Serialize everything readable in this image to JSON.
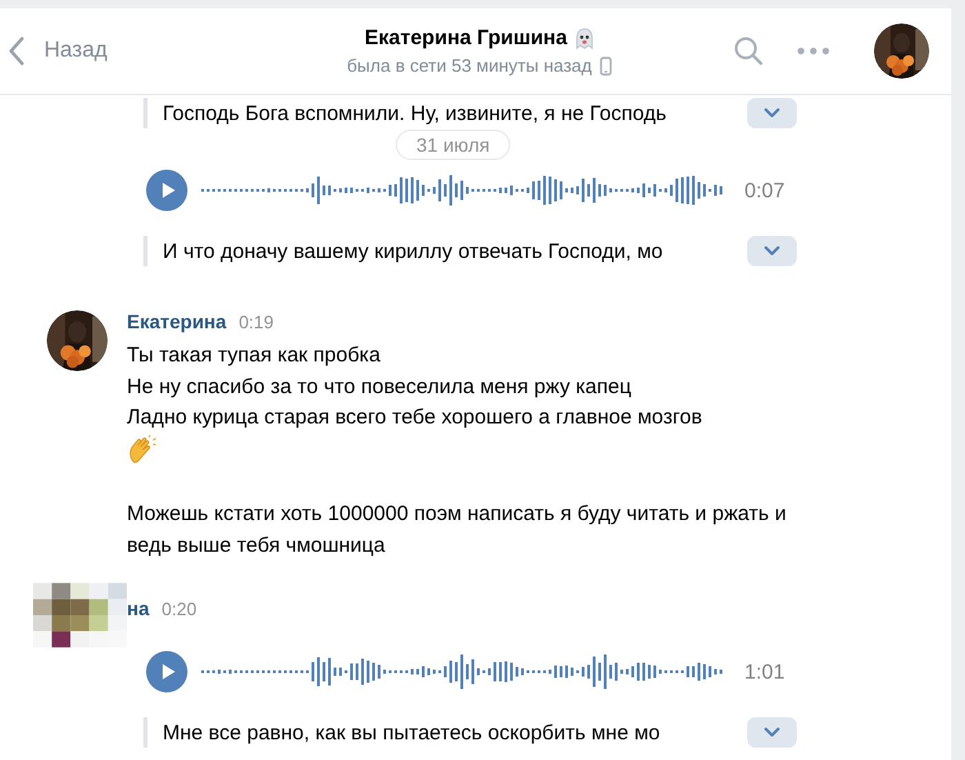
{
  "header": {
    "back": "Назад",
    "title": "Екатерина Гришина",
    "status": "была в сети 53 минуты назад"
  },
  "date_divider": "31 июля",
  "messages": [
    {
      "kind": "continuation",
      "items": [
        {
          "kind": "transcript",
          "text": "Господь Бога вспомнили. Ну, извините, я не Господь"
        },
        {
          "kind": "voice",
          "duration": "0:07"
        },
        {
          "kind": "transcript",
          "text": "И что доначу вашему кириллу отвечать Господи, мо"
        }
      ]
    },
    {
      "author": "Екатерина",
      "time": "0:19",
      "items": [
        {
          "kind": "text",
          "text": "Ты такая тупая как пробка"
        },
        {
          "kind": "text",
          "text": "Не ну спасибо за то что повеселила меня ржу капец"
        },
        {
          "kind": "text",
          "text": "Ладно курица старая всего тебе хорошего а главное мозгов"
        },
        {
          "kind": "clap"
        },
        {
          "kind": "gap"
        },
        {
          "kind": "text",
          "text": "Можешь кстати хоть 1000000 поэм написать я буду читать и ржать и ведь выше тебя чмошница"
        }
      ]
    },
    {
      "kind": "pixelated",
      "author": "на",
      "time": "0:20",
      "items": [
        {
          "kind": "voice",
          "duration": "1:01"
        },
        {
          "kind": "transcript",
          "text": "Мне все равно, как вы пытаетесь оскорбить мне мо"
        }
      ]
    }
  ]
}
